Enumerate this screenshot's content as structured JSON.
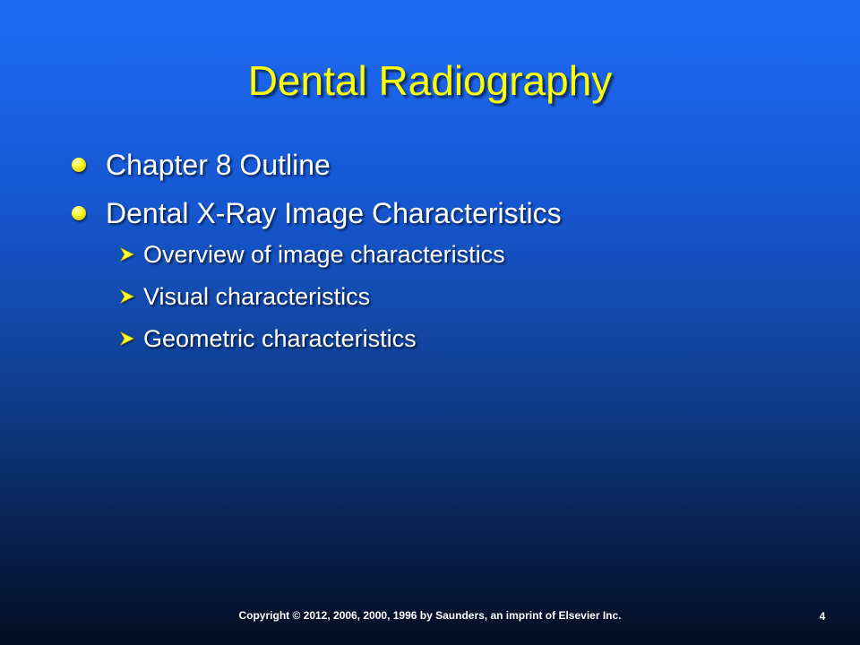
{
  "slide": {
    "title": "Dental Radiography",
    "bullets": [
      {
        "text": "Chapter 8 Outline"
      },
      {
        "text": "Dental X-Ray Image Characteristics"
      }
    ],
    "subbullets": [
      {
        "text": "Overview of image characteristics"
      },
      {
        "text": "Visual characteristics"
      },
      {
        "text": "Geometric characteristics"
      }
    ],
    "footer": "Copyright © 2012, 2006, 2000, 1996 by Saunders, an imprint of Elsevier Inc.",
    "page_number": "4"
  },
  "colors": {
    "title": "#ffff00",
    "bullet_dot": "#ffff33",
    "body_text": "#ffffff",
    "background_top": "#1c6cf3",
    "background_bottom": "#030d22"
  },
  "icons": {
    "level1": "yellow-dot-bullet-icon",
    "level2": "yellow-arrow-bullet-icon"
  }
}
